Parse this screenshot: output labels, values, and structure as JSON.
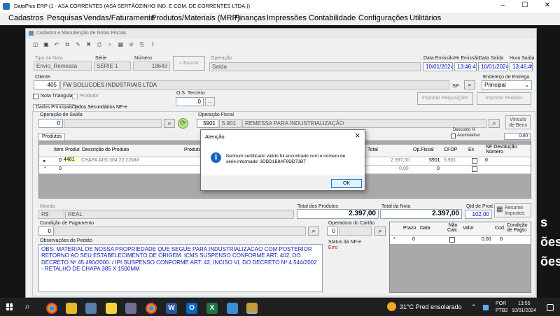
{
  "window": {
    "title": "DataPlus ERP (1 - ASA CORRENTES  (ASA SERTÃOZINHO IND. E COM. DE CORRENTES LTDA.))"
  },
  "menu": [
    "Cadastros",
    "Pesquisas",
    "Vendas/Faturamento",
    "Produtos/Materiais (MRP)",
    "Finanças",
    "Impressões",
    "Contabilidade",
    "Configurações",
    "Utilitários"
  ],
  "form": {
    "title": "Cadastro e Manutenção de Notas Fiscais",
    "tipo_label": "Tipo da Nota",
    "tipo_value": "Envio_Remessa",
    "serie_label": "Série",
    "serie_value": "SÉRIE 1",
    "numero_label": "Número",
    "numero_value": "18643",
    "buscar": "Buscar",
    "operacao_label": "Operação",
    "operacao_value": "Saída",
    "data_emissao_label": "Data Emissão",
    "data_emissao": "10/01/2024",
    "hr_emissao_label": "Hr Emissão",
    "hr_emissao": "13:46:49",
    "data_saida_label": "Data Saída",
    "data_saida": "10/01/2024",
    "hora_saida_label": "Hora Saída",
    "hora_saida": "13:46:49",
    "cliente_label": "Cliente",
    "cliente_code": "405",
    "cliente_name": "FW SOLUCOES INDUSTRIAIS LTDA",
    "cliente_uf": "SP",
    "endereco_label": "Endereço de Entrega",
    "endereco_value": "Principal",
    "nota_triangular": "Nota Triangular",
    "produtor": "Produtor",
    "os_label": "O.S. Terceiro",
    "os_value": "0",
    "os_btn": "...",
    "importar_req": "Importar Requisições",
    "importar_ped": "Importar Pedidos",
    "tabs": [
      "Dados Principais",
      "Dados Secundários",
      "NF-e"
    ],
    "op_saida_label": "Operação de Saída",
    "op_saida_value": "0",
    "op_fiscal_label": "Operação Fiscal",
    "op_fiscal_code": "5901",
    "op_fiscal_cfop": "5.901",
    "op_fiscal_desc": "REMESSA PARA INDUSTRIALIZAÇÃO",
    "vinculo": [
      "Vínculo",
      "de Bens"
    ],
    "produtos_tab": "Produtos",
    "desconto_label": "Desconto %",
    "acumulativo": "Acumulativo",
    "desconto_value": "0,00",
    "grid_headers": [
      "Item",
      "Produt",
      "Descrição do Produto",
      "Produto",
      "Total",
      "Op.Fiscal",
      "CFOP",
      "Ex",
      "NF Devolução",
      "Número"
    ],
    "row1": {
      "marker": "▸",
      "item": "0",
      "produto": "4481",
      "descricao": "CHAPA AISI 304 22,22MM",
      "total": "2.397,00",
      "opfiscal": "5901",
      "cfop": "5.901",
      "nfdev": "0"
    },
    "row2": {
      "marker": "*",
      "item": "0",
      "total": "0,00",
      "opfiscal": "0"
    },
    "moeda_label": "Moeda",
    "moeda_code": "R$",
    "moeda_name": "REAL",
    "total_produtos_label": "Total dos Produtos",
    "total_produtos": "2.397,00",
    "total_nota_label": "Total da Nota",
    "total_nota": "2.397,00",
    "qtd_prod_label": "Qtd de Prod.",
    "qtd_prod": "102,00",
    "resumo": [
      "Resumo",
      "Impostos"
    ],
    "cond_pag_label": "Condição de Pagamento",
    "cond_pag_value": "0",
    "op_cartao_label": "Operadora do Cartão",
    "op_cartao_value": "0",
    "obs_label": "Observações do Pedido",
    "obs_text": "OBS: MATERIAL DE NOSSA PROPRIEDADE QUE SEGUE PARA INDUSTRIALIZACAO COM POSTERIOR RETORNO AO SEU ESTABELECIMENTO DE ORIGEM. ICMS SUSPENSO CONFORME ART. 402,  DO DECRETO Nº 45.490/2000. / IPI SUSPENSO CONFORME ART. 42, INCISO VI, DO DECRETO Nº 4.544/2002 - RETALHO DE CHAPA 385 X 1500MM",
    "status_nfe_label": "Status da NF-e",
    "status_nfe_value": "Erro",
    "parcelas_headers": [
      "Prazo",
      "Data",
      "Não Calc.",
      "Valor",
      "Cod.",
      "Condição de Pagto"
    ],
    "parcela_row": {
      "marker": "*",
      "prazo": "0",
      "valor": "0,00",
      "cod": "0"
    }
  },
  "dialog": {
    "title": "Atenção",
    "message_line1": "Nenhum certificado válido foi encontrado com o número de",
    "message_line2": "série informado: 3DBD1B8AF9DD73B7",
    "ok": "OK"
  },
  "taskbar": {
    "weather": "31°C  Pred ensolarado",
    "lang1": "POR",
    "lang2": "PTB2",
    "time": "13:55",
    "date": "10/01/2024",
    "bg_text": [
      "s",
      "ões",
      "ões"
    ]
  },
  "colors": {
    "accent": "#0078d7",
    "title_bg": "#ffffff",
    "form_bg": "#f0f0f0",
    "error": "#d40000"
  }
}
